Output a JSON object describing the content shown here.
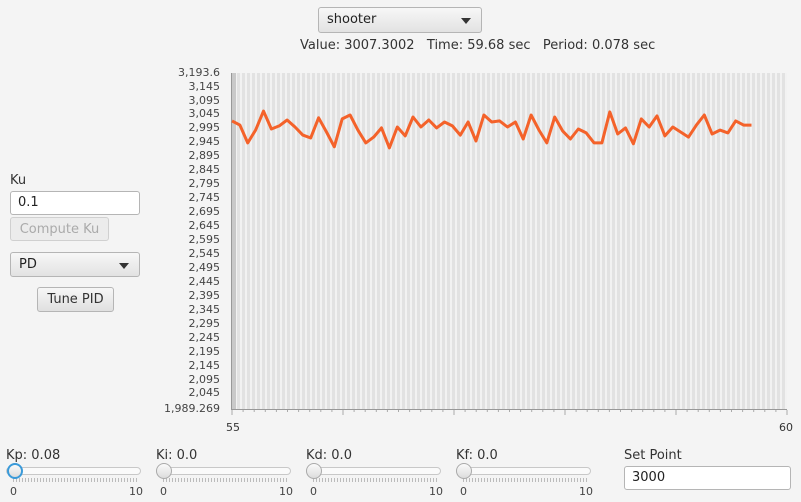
{
  "subsystem_select": {
    "value": "shooter"
  },
  "status": {
    "text": "Value: 3007.3002   Time: 59.68 sec   Period: 0.078 sec"
  },
  "left": {
    "ku_label": "Ku",
    "ku_value": "0.1",
    "compute_ku": "Compute Ku",
    "mode_select": "PD",
    "tune_pid": "Tune PID"
  },
  "sliders": [
    {
      "label": "Kp: 0.08",
      "min": "0",
      "max": "10",
      "value": 0.08
    },
    {
      "label": "Ki: 0.0",
      "min": "0",
      "max": "10",
      "value": 0
    },
    {
      "label": "Kd: 0.0",
      "min": "0",
      "max": "10",
      "value": 0
    },
    {
      "label": "Kf: 0.0",
      "min": "0",
      "max": "10",
      "value": 0
    }
  ],
  "setpoint": {
    "label": "Set Point",
    "value": "3000"
  },
  "colors": {
    "line": "#f4622a"
  },
  "chart_data": {
    "type": "line",
    "ylim": [
      1989.269,
      3193.6
    ],
    "xlim": [
      55,
      60
    ],
    "y_ticks": [
      "3,193.6",
      "3,145",
      "3,095",
      "3,045",
      "2,995",
      "2,945",
      "2,895",
      "2,845",
      "2,795",
      "2,745",
      "2,695",
      "2,645",
      "2,595",
      "2,545",
      "2,495",
      "2,445",
      "2,395",
      "2,345",
      "2,295",
      "2,245",
      "2,195",
      "2,145",
      "2,095",
      "2,045",
      "1,989.269"
    ],
    "y_tick_values": [
      3193.6,
      3145,
      3095,
      3045,
      2995,
      2945,
      2895,
      2845,
      2795,
      2745,
      2695,
      2645,
      2595,
      2545,
      2495,
      2445,
      2395,
      2345,
      2295,
      2245,
      2195,
      2145,
      2095,
      2045,
      1989.269
    ],
    "x_ticks": [
      "55",
      "60"
    ],
    "x_start": 55,
    "x_end": 59.68,
    "values": [
      3022,
      3007,
      2943,
      2989,
      3057,
      2993,
      3004,
      3025,
      3000,
      2971,
      2961,
      3033,
      2982,
      2929,
      3029,
      3043,
      2989,
      2943,
      2964,
      2997,
      2925,
      3000,
      2968,
      3036,
      3000,
      3025,
      2997,
      3018,
      3004,
      2971,
      3018,
      2950,
      3043,
      3018,
      3022,
      3000,
      3018,
      2957,
      3043,
      2989,
      2943,
      3036,
      2986,
      2957,
      2993,
      2979,
      2943,
      2943,
      3054,
      2975,
      2997,
      2940,
      3029,
      3000,
      3040,
      2968,
      3000,
      2982,
      2964,
      3007,
      3043,
      2975,
      2989,
      2979,
      3022,
      3007,
      3007
    ]
  }
}
